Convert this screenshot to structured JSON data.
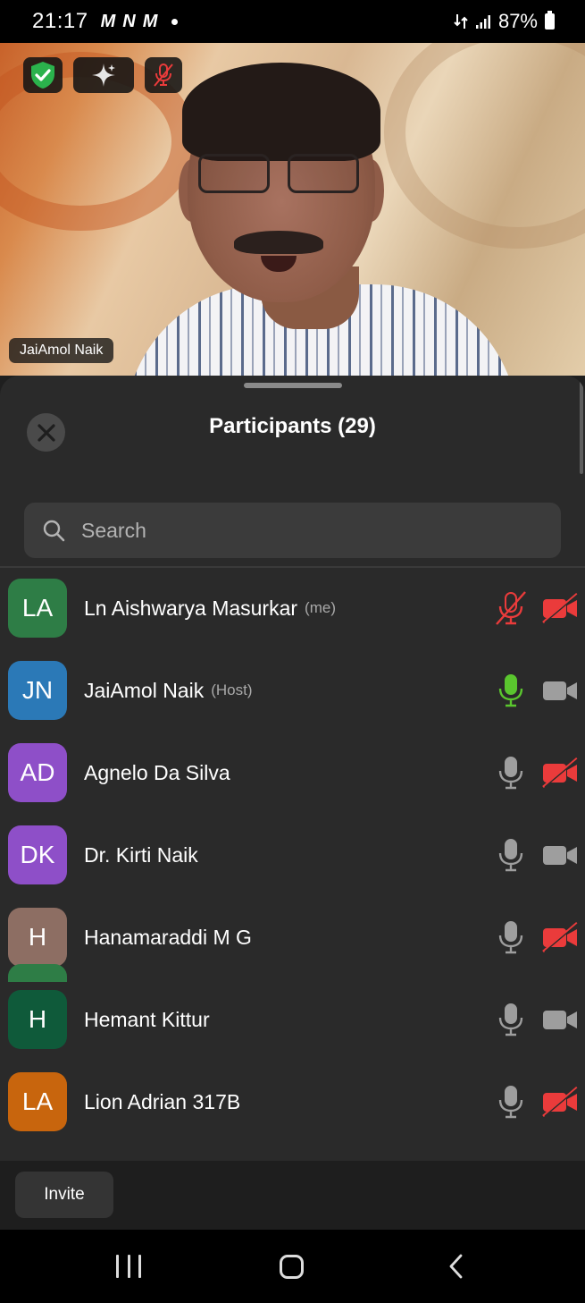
{
  "status_bar": {
    "time": "21:17",
    "notification_icons": [
      "M",
      "N",
      "M"
    ],
    "battery": "87%"
  },
  "video": {
    "speaker_name": "JaiAmol Naik",
    "badges": [
      "shield-check-icon",
      "sparkle-icon",
      "mic-muted-icon"
    ]
  },
  "participants": {
    "title": "Participants (29)",
    "search_placeholder": "Search",
    "list": [
      {
        "initials": "LA",
        "name": "Ln Aishwarya Masurkar",
        "role": "(me)",
        "avatar_color": "#2e7d46",
        "mic": "muted",
        "video": "off"
      },
      {
        "initials": "JN",
        "name": "JaiAmol Naik",
        "role": "(Host)",
        "avatar_color": "#2b79b7",
        "mic": "speaking",
        "video": "on"
      },
      {
        "initials": "AD",
        "name": "Agnelo Da Silva",
        "role": "",
        "avatar_color": "#8e4fc8",
        "mic": "on",
        "video": "off"
      },
      {
        "initials": "DK",
        "name": "Dr. Kirti Naik",
        "role": "",
        "avatar_color": "#8e4fc8",
        "mic": "on",
        "video": "on"
      },
      {
        "initials": "H",
        "name": "Hanamaraddi M G",
        "role": "",
        "avatar_color": "#8d6e63",
        "mic": "on",
        "video": "off"
      },
      {
        "initials": "H",
        "name": "Hemant Kittur",
        "role": "",
        "avatar_color": "#0f5a3a",
        "mic": "on",
        "video": "on"
      },
      {
        "initials": "LA",
        "name": "Lion Adrian 317B",
        "role": "",
        "avatar_color": "#c8650d",
        "mic": "on",
        "video": "off"
      }
    ]
  },
  "footer": {
    "invite_label": "Invite"
  },
  "colors": {
    "muted_red": "#ea3b3b",
    "speaking_green": "#5ac62e",
    "icon_gray": "#9e9e9e"
  }
}
